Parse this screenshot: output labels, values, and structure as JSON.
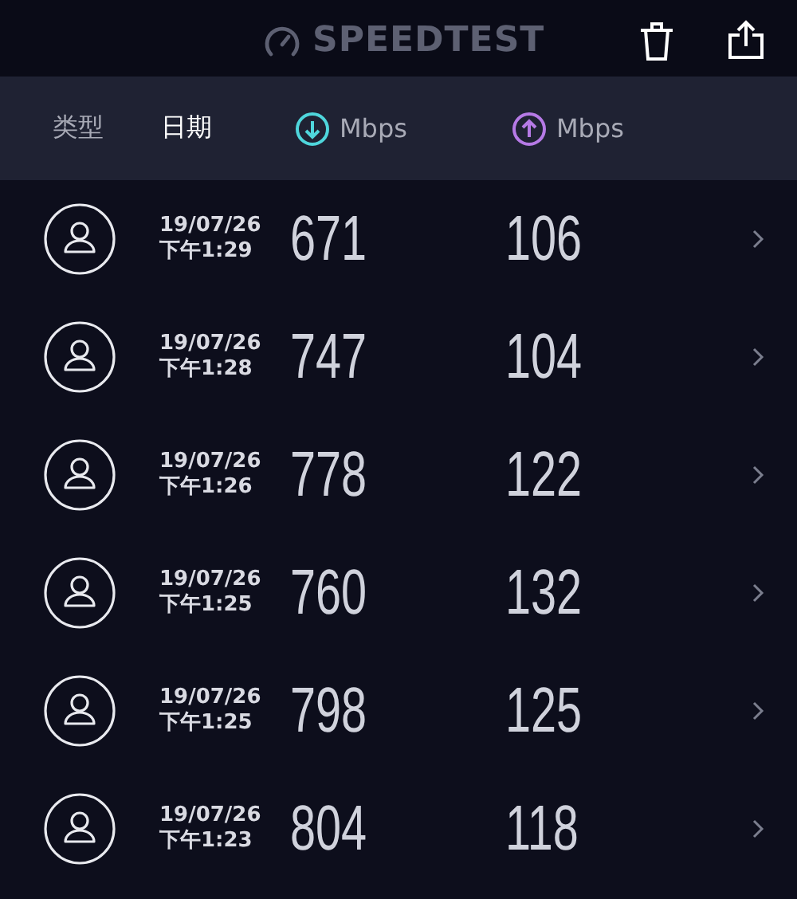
{
  "app_title": "SPEEDTEST",
  "columns": [
    {
      "kind": "text",
      "label": "类型",
      "selected": false
    },
    {
      "kind": "text",
      "label": "日期",
      "selected": true
    },
    {
      "kind": "download",
      "label": "Mbps",
      "selected": false
    },
    {
      "kind": "upload",
      "label": "Mbps",
      "selected": false
    }
  ],
  "results": [
    {
      "date": "19/07/26",
      "time": "下午1:29",
      "download": "671",
      "upload": "106"
    },
    {
      "date": "19/07/26",
      "time": "下午1:28",
      "download": "747",
      "upload": "104"
    },
    {
      "date": "19/07/26",
      "time": "下午1:26",
      "download": "778",
      "upload": "122"
    },
    {
      "date": "19/07/26",
      "time": "下午1:25",
      "download": "760",
      "upload": "132"
    },
    {
      "date": "19/07/26",
      "time": "下午1:25",
      "download": "798",
      "upload": "125"
    },
    {
      "date": "19/07/26",
      "time": "下午1:23",
      "download": "804",
      "upload": "118"
    }
  ]
}
